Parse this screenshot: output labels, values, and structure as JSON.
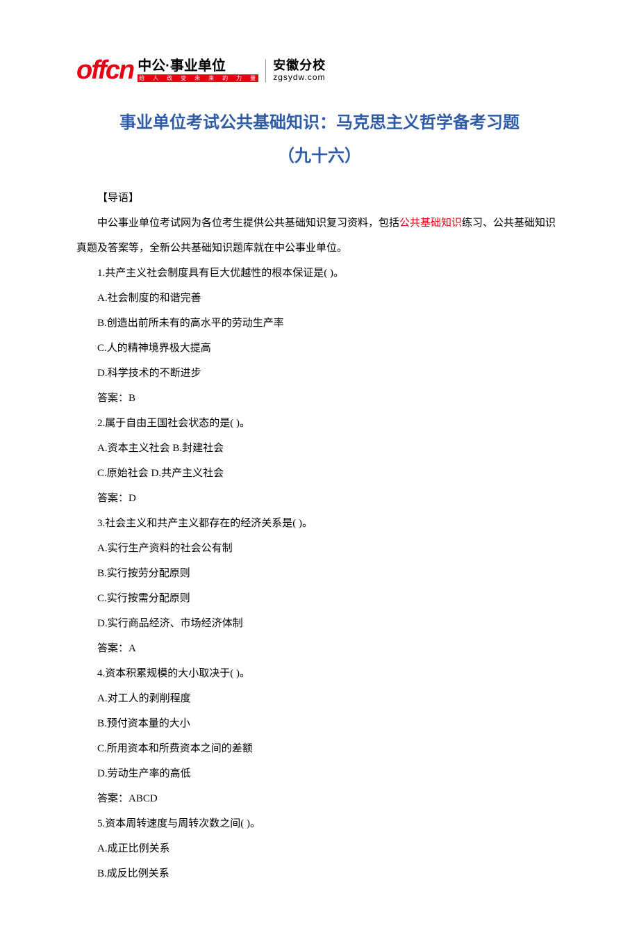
{
  "logo": {
    "brand_en": "offcn",
    "brand_cn": "中公·事业单位",
    "brand_slogan": "给　人　改　变　未　来　的　力　量",
    "branch_cn": "安徽分校",
    "branch_url": "zgsydw.com"
  },
  "title_line1": "事业单位考试公共基础知识：马克思主义哲学备考习题",
  "title_line2": "（九十六）",
  "intro_label": "【导语】",
  "intro_pre": "中公事业单位考试网为各位考生提供公共基础知识复习资料，包括",
  "intro_highlight": "公共基础知识",
  "intro_post": "练习、公共基础知识真题及答案等，全新公共基础知识题库就在中公事业单位。",
  "lines": {
    "q1": "1.共产主义社会制度具有巨大优越性的根本保证是( )。",
    "q1a": "A.社会制度的和谐完善",
    "q1b": "B.创造出前所未有的高水平的劳动生产率",
    "q1c": "C.人的精神境界极大提高",
    "q1d": "D.科学技术的不断进步",
    "a1": "答案：B",
    "q2": "2.属于自由王国社会状态的是( )。",
    "q2ab": "A.资本主义社会 B.封建社会",
    "q2cd": "C.原始社会 D.共产主义社会",
    "a2": "答案：D",
    "q3": "3.社会主义和共产主义都存在的经济关系是( )。",
    "q3a": "A.实行生产资料的社会公有制",
    "q3b": "B.实行按劳分配原则",
    "q3c": "C.实行按需分配原则",
    "q3d": "D.实行商品经济、市场经济体制",
    "a3": "答案：A",
    "q4": "4.资本积累规模的大小取决于( )。",
    "q4a": "A.对工人的剥削程度",
    "q4b": "B.预付资本量的大小",
    "q4c": "C.所用资本和所费资本之间的差额",
    "q4d": "D.劳动生产率的高低",
    "a4": "答案：ABCD",
    "q5": "5.资本周转速度与周转次数之间( )。",
    "q5a": "A.成正比例关系",
    "q5b": "B.成反比例关系"
  }
}
